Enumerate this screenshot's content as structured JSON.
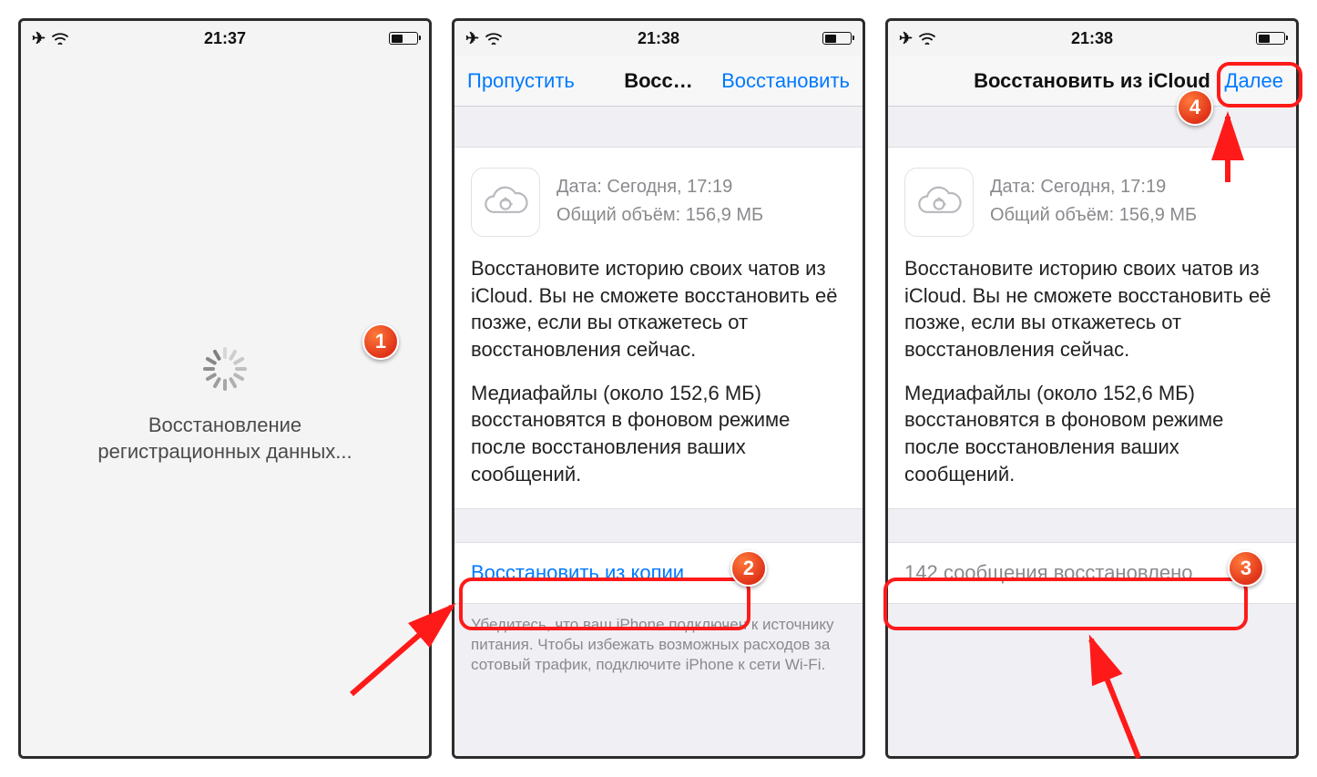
{
  "screen1": {
    "time": "21:37",
    "loading_line1": "Восстановление",
    "loading_line2": "регистрационных данных..."
  },
  "screen2": {
    "time": "21:38",
    "nav_skip": "Пропустить",
    "nav_title": "Восс…",
    "nav_restore": "Восстановить",
    "date_line": "Дата: Сегодня, 17:19",
    "size_line": "Общий объём: 156,9 МБ",
    "para1": "Восстановите историю своих чатов из iCloud. Вы не сможете восстановить её позже, если вы откажетесь от восстановления сейчас.",
    "para2": "Медиафайлы (около 152,6 МБ) восстановятся в фоновом режиме после восстановления ваших сообщений.",
    "action": "Восстановить из копии",
    "footnote": "Убедитесь, что ваш iPhone подключен к источнику питания. Чтобы избежать возможных расходов за сотовый трафик, подключите iPhone к сети Wi-Fi."
  },
  "screen3": {
    "time": "21:38",
    "nav_title": "Восстановить из iCloud",
    "nav_next": "Далее",
    "date_line": "Дата: Сегодня, 17:19",
    "size_line": "Общий объём: 156,9 МБ",
    "para1": "Восстановите историю своих чатов из iCloud. Вы не сможете восстановить её позже, если вы откажетесь от восстановления сейчас.",
    "para2": "Медиафайлы (около 152,6 МБ) восстановятся в фоновом режиме после восстановления ваших сообщений.",
    "result": "142 сообщения восстановлено"
  },
  "badges": {
    "1": "1",
    "2": "2",
    "3": "3",
    "4": "4"
  }
}
